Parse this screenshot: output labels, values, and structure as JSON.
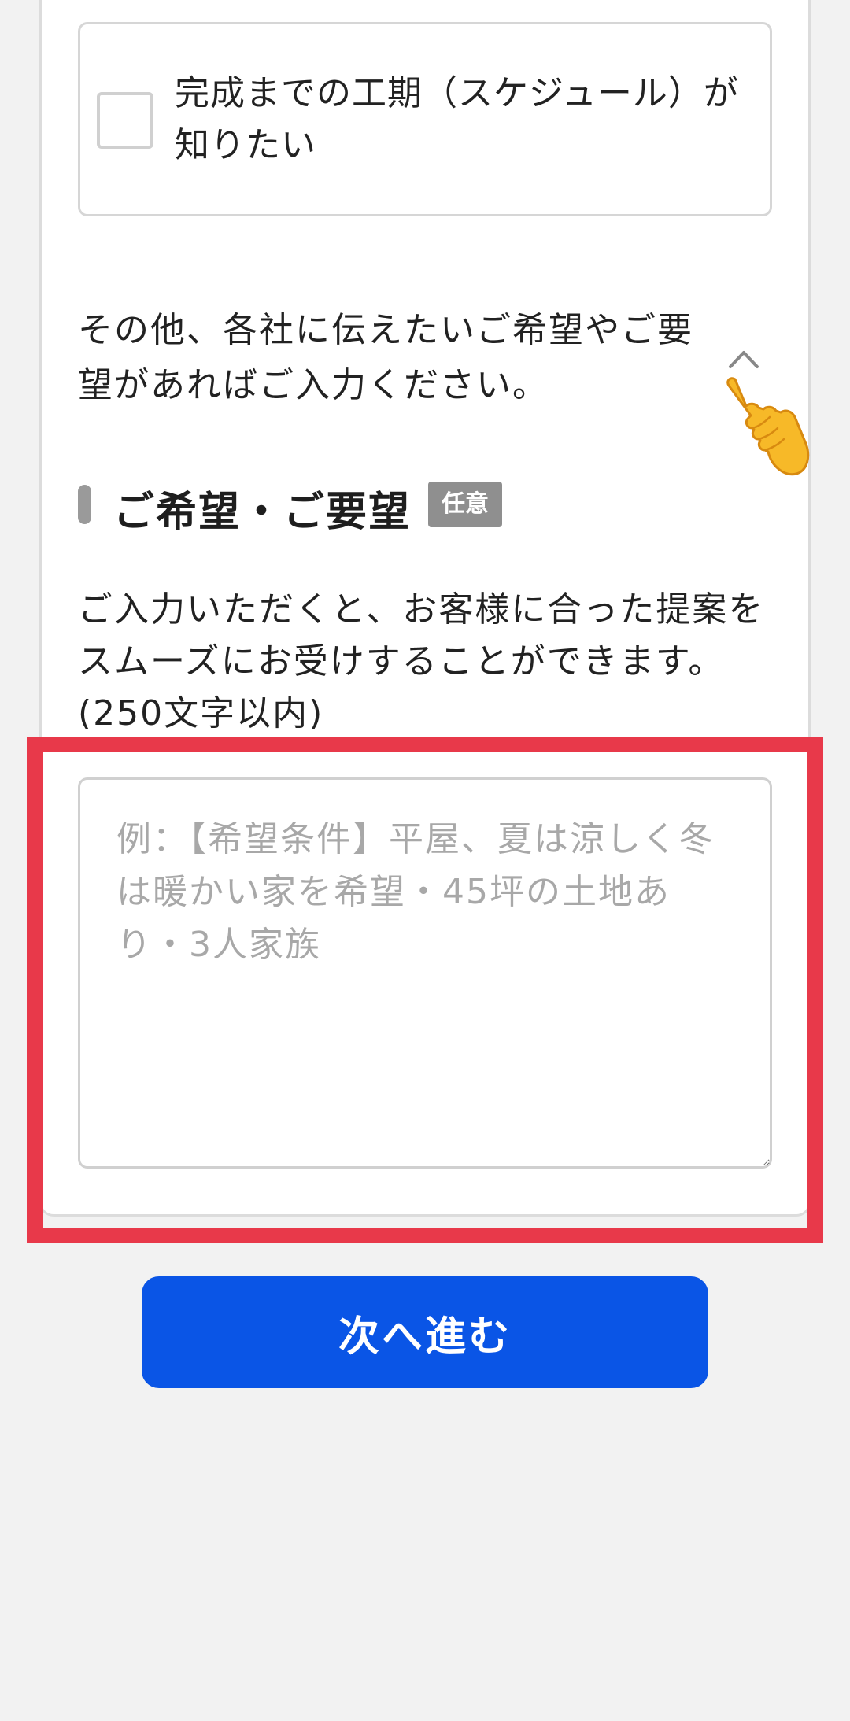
{
  "option": {
    "label": "完成までの工期（スケジュール）が知りたい",
    "checked": false
  },
  "intro": {
    "text": "その他、各社に伝えたいご希望やご要望があればご入力ください。"
  },
  "icons": {
    "toggle": "chevron-up-icon",
    "pointer": "pointing-hand-icon"
  },
  "section": {
    "title": "ご希望・ご要望",
    "badge": "任意",
    "description": "ご入力いただくと、お客様に合った提案をスムーズにお受けすることができます。(250文字以内)"
  },
  "textarea": {
    "value": "",
    "placeholder": "例：【希望条件】平屋、夏は涼しく冬は暖かい家を希望・45坪の土地あり・3人家族",
    "max_length": 250
  },
  "button": {
    "next_label": "次へ進む"
  },
  "colors": {
    "primary_button": "#0a55e6",
    "highlight": "#e8394a",
    "badge": "#8f8f8f",
    "background": "#f2f2f2"
  }
}
